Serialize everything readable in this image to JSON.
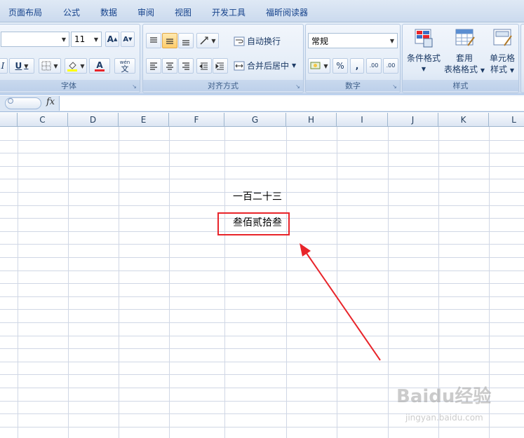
{
  "menu": {
    "tabs": [
      "页面布局",
      "公式",
      "数据",
      "审阅",
      "视图",
      "开发工具",
      "福昕阅读器"
    ]
  },
  "ribbon": {
    "font": {
      "size_value": "11",
      "grow_label": "A",
      "shrink_label": "A",
      "italic_label": "I",
      "underline_label": "U",
      "font_color_label": "A",
      "phonetic_top": "wén",
      "phonetic_bottom": "文",
      "group_label": "字体"
    },
    "alignment": {
      "wrap_text_label": "自动换行",
      "merge_center_label": "合并后居中",
      "group_label": "对齐方式"
    },
    "number": {
      "format_value": "常规",
      "percent_label": "%",
      "comma_label": ",",
      "inc_decimal_label": ".00",
      "dec_decimal_label": ".00",
      "group_label": "数字"
    },
    "styles": {
      "conditional_format_label": "条件格式",
      "table_format_line1": "套用",
      "table_format_line2": "表格格式",
      "cell_styles_line1": "单元格",
      "cell_styles_line2": "样式",
      "group_label": "样式"
    }
  },
  "formula_bar": {
    "fx_label": "fx",
    "formula_value": ""
  },
  "grid": {
    "columns": [
      "C",
      "D",
      "E",
      "F",
      "G",
      "H",
      "I",
      "J",
      "K",
      "L"
    ],
    "cells": {
      "g_row_a": "一百二十三",
      "g_row_b": "叁佰贰拾叁"
    }
  },
  "colors": {
    "highlight_box": "#e8242a",
    "arrow": "#e8242a",
    "ribbon_blue": "#15428b",
    "gridline": "#d0d7e5"
  },
  "watermark": {
    "main": "Baidu经验",
    "sub": "jingyan.baidu.com"
  }
}
